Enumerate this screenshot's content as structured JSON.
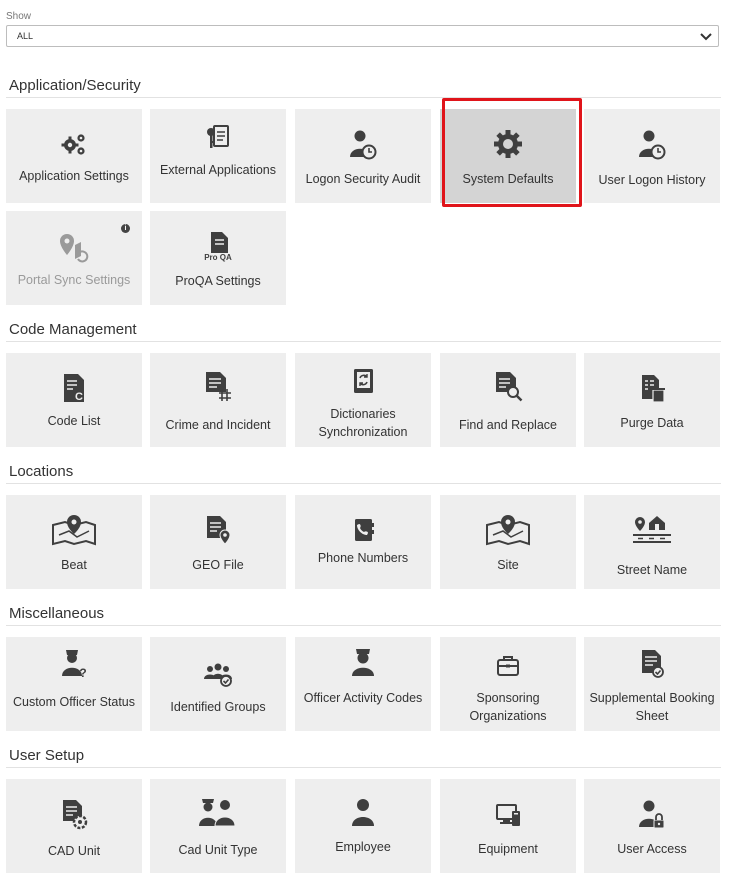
{
  "filter": {
    "label": "Show",
    "value": "ALL"
  },
  "sections": {
    "app_security": {
      "title": "Application/Security",
      "tiles": [
        "Application Settings",
        "External Applications",
        "Logon Security Audit",
        "System Defaults",
        "User Logon History",
        "Portal Sync Settings",
        "ProQA Settings"
      ]
    },
    "code_mgmt": {
      "title": "Code Management",
      "tiles": [
        "Code List",
        "Crime and Incident",
        "Dictionaries Synchronization",
        "Find and Replace",
        "Purge Data"
      ]
    },
    "locations": {
      "title": "Locations",
      "tiles": [
        "Beat",
        "GEO File",
        "Phone Numbers",
        "Site",
        "Street Name"
      ]
    },
    "misc": {
      "title": "Miscellaneous",
      "tiles": [
        "Custom Officer Status",
        "Identified Groups",
        "Officer Activity Codes",
        "Sponsoring Organizations",
        "Supplemental Booking Sheet"
      ]
    },
    "user_setup": {
      "title": "User Setup",
      "tiles": [
        "CAD Unit",
        "Cad Unit Type",
        "Employee",
        "Equipment",
        "User Access"
      ]
    }
  },
  "icons": {
    "color": "#3f3f3f"
  }
}
